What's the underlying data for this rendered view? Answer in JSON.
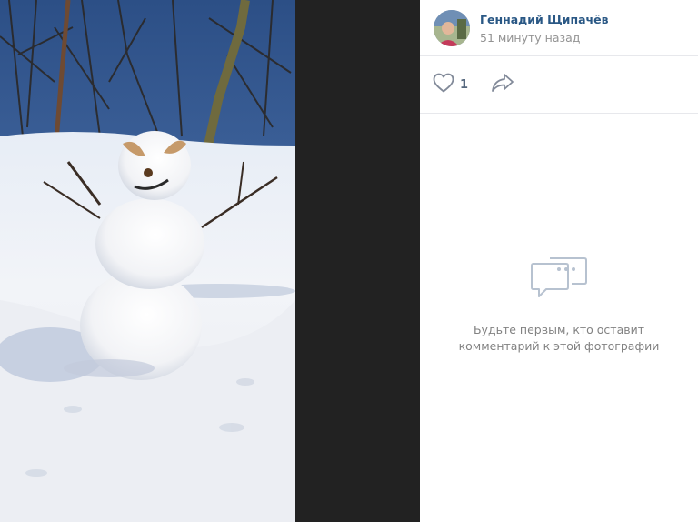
{
  "post": {
    "author_name": "Геннадий Щипачёв",
    "time_ago": "51 минуту назад",
    "likes": "1"
  },
  "icons": {
    "like": "heart-icon",
    "share": "share-arrow-icon",
    "comments": "chat-bubble-icon"
  },
  "comments": {
    "empty_text": "Будьте первым, кто оставит комментарий к этой фотографии"
  },
  "colors": {
    "author_link": "#2a5885",
    "muted": "#939393",
    "icon": "#828a99",
    "viewer_bg": "#222222"
  }
}
